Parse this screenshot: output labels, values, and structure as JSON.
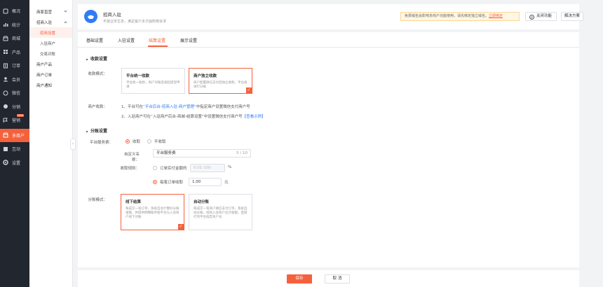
{
  "sidebar": {
    "items": [
      {
        "label": "概况",
        "icon": "overview-icon"
      },
      {
        "label": "统计",
        "icon": "stats-icon"
      },
      {
        "label": "商城",
        "icon": "shop-icon"
      },
      {
        "label": "产品",
        "icon": "product-icon"
      },
      {
        "label": "订单",
        "icon": "order-icon"
      },
      {
        "label": "会员",
        "icon": "member-icon"
      },
      {
        "label": "微信",
        "icon": "wechat-icon"
      },
      {
        "label": "分销",
        "icon": "distribution-icon"
      },
      {
        "label": "营销",
        "icon": "marketing-icon",
        "badge": "NEW"
      },
      {
        "label": "多商户",
        "icon": "multi-merchant-icon",
        "active": true
      },
      {
        "label": "互动",
        "icon": "interact-icon"
      },
      {
        "label": "设置",
        "icon": "settings-icon"
      }
    ]
  },
  "subnav": {
    "items": [
      {
        "label": "商家直营",
        "type": "group"
      },
      {
        "label": "招商入驻",
        "type": "group"
      },
      {
        "label": "招商设置",
        "type": "child",
        "selected": true
      },
      {
        "label": "入驻商户",
        "type": "child"
      },
      {
        "label": "交易对账",
        "type": "child"
      },
      {
        "label": "商户产品",
        "type": "group"
      },
      {
        "label": "商户订单",
        "type": "group"
      },
      {
        "label": "商户通知",
        "type": "group"
      }
    ]
  },
  "header": {
    "title": "招商入驻",
    "desc": "丰富业务生态，满足客户多方面购物诉求",
    "notice_text": "免费域名会影响多商户功能使用，请先绑定独立域名。",
    "notice_link": "立即绑定",
    "close_label": "关闭功能",
    "solution_label": "解决方案"
  },
  "tabs": [
    "基础设置",
    "入驻设置",
    "结算设置",
    "展示设置"
  ],
  "active_tab": "结算设置",
  "collect": {
    "section_title": "收款设置",
    "mode_label": "收款模式：",
    "cards": [
      {
        "title": "平台统一收款",
        "desc": "平台统一收款，商户对账后发起提现申请",
        "selected": false
      },
      {
        "title": "商户独立收款",
        "desc": "商户配置微信支付后独立收款，平台再进行分账",
        "selected": true
      }
    ],
    "merchant_label": "商户收款：",
    "line1_pre": "1、平台可在",
    "line1_link": "“平台后台-招商入驻-商户管理”",
    "line1_post": "中指定商户设置微信支付商户号",
    "line2_pre": "2、入驻商户可在“入驻商户后台-商城-结算设置”中设置微信支付商户号",
    "line2_link": "【查看示例】"
  },
  "split": {
    "section_title": "分账设置",
    "fee_label": "平台服务费：",
    "fee_options": [
      "收取",
      "不收取"
    ],
    "name_label": "自定义名称：",
    "name_value": "平台服务费",
    "name_count": "5 / 10",
    "rule_label": "收取规则：",
    "rule_ratio_label": "订单实付金额的",
    "rule_ratio_placeholder": "0.01-100",
    "rule_ratio_unit": "%",
    "rule_fixed_label": "每笔订单收取",
    "rule_fixed_value": "1.00",
    "rule_fixed_unit": "元",
    "mode_label": "分账模式：",
    "cards": [
      {
        "title": "线下结算",
        "desc": "每成交一笔订单，系统自动计算好分账金额，并提供明细账单给平台与入驻商户线下对账",
        "selected": true
      },
      {
        "title": "自动分账",
        "desc": "每成交一笔商户微信支付订单，系统自动分账，扣除入驻商户应付金额，直接打到平台指定商户号",
        "selected": false
      }
    ]
  },
  "footer": {
    "save_label": "保存",
    "cancel_label": "取 消"
  },
  "colors": {
    "accent": "#f5613c",
    "sidebar_bg": "#22262e",
    "link": "#2f7cf6"
  }
}
